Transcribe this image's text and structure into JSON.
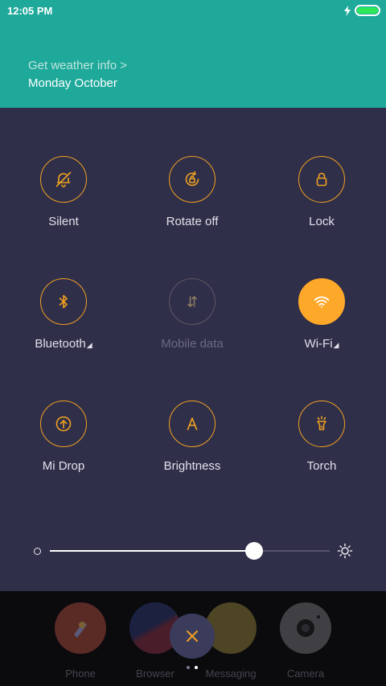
{
  "status_bar": {
    "time": "12:05 PM",
    "charging_icon": "bolt-icon",
    "battery_icon": "battery-icon",
    "battery_color": "#2ee85a"
  },
  "header": {
    "weather_link": "Get weather info >",
    "date": "Monday October",
    "background": "#1fa99a"
  },
  "toggles": [
    {
      "label": "Silent",
      "icon": "bell-off-icon",
      "state": "off"
    },
    {
      "label": "Rotate off",
      "icon": "rotate-lock-icon",
      "state": "off"
    },
    {
      "label": "Lock",
      "icon": "lock-icon",
      "state": "off"
    },
    {
      "label": "Bluetooth",
      "icon": "bluetooth-icon",
      "state": "off",
      "has_submenu": true
    },
    {
      "label": "Mobile data",
      "icon": "mobile-data-icon",
      "state": "disabled"
    },
    {
      "label": "Wi-Fi",
      "icon": "wifi-icon",
      "state": "on",
      "has_submenu": true
    },
    {
      "label": "Mi Drop",
      "icon": "upload-icon",
      "state": "off"
    },
    {
      "label": "Brightness",
      "icon": "auto-brightness-icon",
      "state": "off"
    },
    {
      "label": "Torch",
      "icon": "flashlight-icon",
      "state": "off"
    }
  ],
  "submenu_marker": "◢",
  "brightness": {
    "level": 0.73,
    "min_icon": "brightness-low-icon",
    "max_icon": "brightness-high-icon"
  },
  "dock": {
    "apps": [
      {
        "label": "Phone",
        "icon": "phone-app-icon"
      },
      {
        "label": "Browser",
        "icon": "browser-app-icon"
      },
      {
        "label": "Messaging",
        "icon": "messaging-app-icon"
      },
      {
        "label": "Camera",
        "icon": "camera-app-icon"
      }
    ],
    "close_icon": "close-icon",
    "page_count": 2,
    "current_page": 2
  },
  "colors": {
    "accent": "#fea82a",
    "panel": "#302f49",
    "header": "#1fa99a"
  }
}
